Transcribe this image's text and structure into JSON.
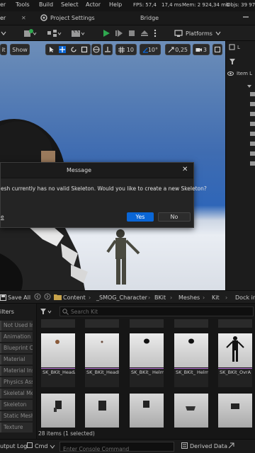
{
  "menu": {
    "item1": "er",
    "tools": "Tools",
    "build": "Build",
    "select": "Select",
    "actor": "Actor",
    "help": "Help",
    "fps": "FPS: 57,4",
    "ms": "17,4 ms",
    "mem": "Mem: 2 924,34 mb",
    "objs": "Objs: 39 97"
  },
  "tabs": {
    "first": "er",
    "project_settings": "Project Settings",
    "bridge": "Bridge"
  },
  "toolbar": {
    "platforms": "Platforms"
  },
  "viewport": {
    "lit": "it",
    "show": "Show",
    "grid": "10",
    "angle": "10°",
    "scale": "0,25",
    "cam": "3"
  },
  "outliner": {
    "header": "L",
    "item_label": "Item L"
  },
  "dialog": {
    "title": "Message",
    "message": "esh currently has no valid Skeleton. Would you like to create a new Skeleton?",
    "link": "e",
    "yes": "Yes",
    "no": "No"
  },
  "content_browser": {
    "save_all": "Save All",
    "breadcrumb": [
      "Content",
      "_SMOG_Character",
      "BKit",
      "Meshes",
      "Kit"
    ],
    "dock": "Dock in",
    "filters_label": "ilters",
    "search_placeholder": "Search Kit",
    "filters": [
      "Not Used In",
      "Animation S",
      "Blueprint Cl",
      "Material",
      "Material Ins",
      "Physics Ass",
      "Skeletal Me",
      "Skeleton",
      "Static Mesh",
      "Texture"
    ],
    "assets": [
      {
        "label": "SK_BKit_HeadA"
      },
      {
        "label": "SK_BKit_HeadB"
      },
      {
        "label": "SK_BKit_ HelmetA"
      },
      {
        "label": "SK_BKit_ HelmetB"
      },
      {
        "label": "SK_BKit_OvrA"
      }
    ],
    "status": "28 items (1 selected)"
  },
  "bottom": {
    "output_log": "utput Log",
    "cmd": "Cmd",
    "console_placeholder": "Enter Console Command",
    "derived_data": "Derived Data"
  },
  "colors": {
    "accent": "#0a66d6",
    "play": "#2fa84f"
  }
}
